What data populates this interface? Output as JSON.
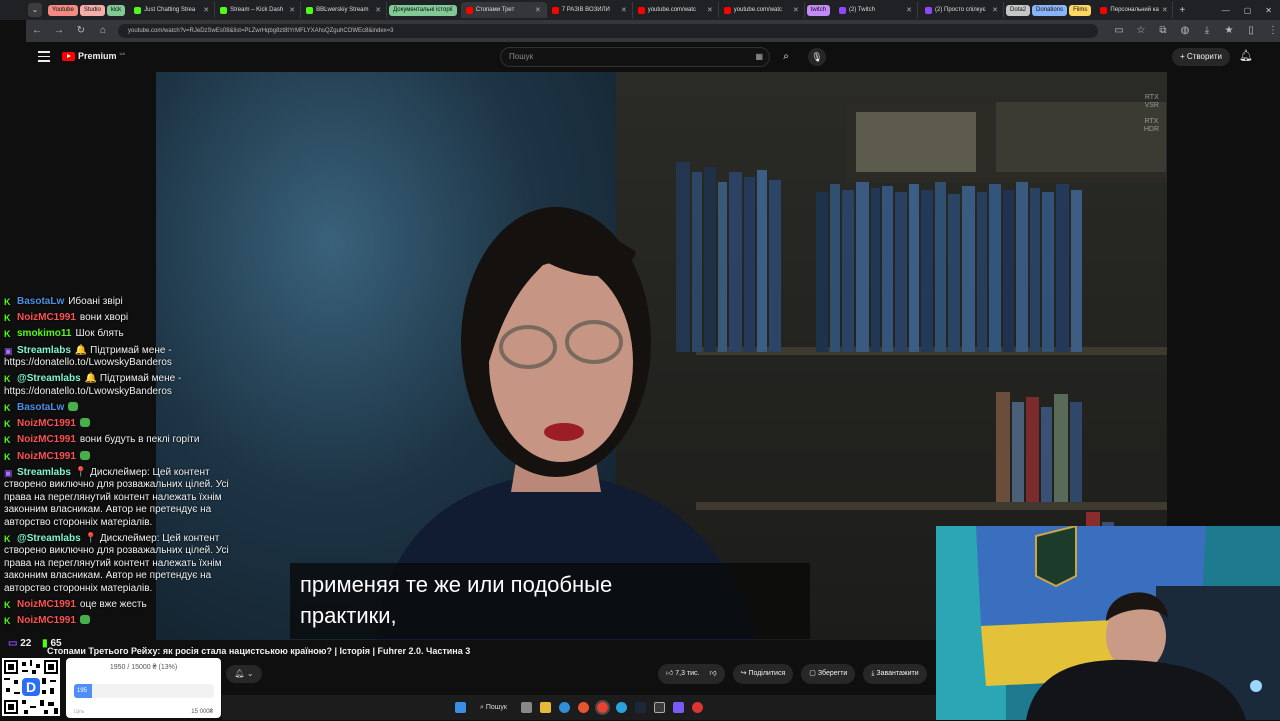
{
  "browser": {
    "groups": [
      {
        "label": "Youtube",
        "color": "#f28b82"
      },
      {
        "label": "Studio",
        "color": "#f6aea9"
      },
      {
        "label": "kick",
        "color": "#81c995"
      }
    ],
    "tabs": [
      {
        "title": "Just Chatting Strea",
        "icon_color": "#53fc18"
      },
      {
        "title": "Stream – Kick Dash",
        "icon_color": "#53fc18"
      },
      {
        "title": "BBLwerskiy Stream",
        "icon_color": "#53fc18"
      }
    ],
    "group_doc": {
      "label": "Документальні історії",
      "color": "#81c995"
    },
    "tabs2": [
      {
        "title": "Стопами Трет",
        "icon_color": "#ff0000",
        "active": true
      },
      {
        "title": "7 РАЗІВ ВОЗИЛИ",
        "icon_color": "#ff0000"
      },
      {
        "title": "youtube.com/watc",
        "icon_color": "#ff0000"
      },
      {
        "title": "youtube.com/watc",
        "icon_color": "#ff0000"
      }
    ],
    "group_twitch": {
      "label": "twitch",
      "color": "#c58af9"
    },
    "tab_twitch": {
      "title": "(2) Twitch",
      "icon_color": "#9146ff"
    },
    "tab_spilk": {
      "title": "(2) Просто спілкує",
      "icon_color": "#9146ff"
    },
    "groups_right": [
      {
        "label": "Dota2",
        "color": "#c4c7c5"
      },
      {
        "label": "Donations",
        "color": "#8ab4f8"
      },
      {
        "label": "Films",
        "color": "#fdd663"
      }
    ],
    "tab_personal": {
      "title": "Персональний ка",
      "icon_color": "#ff0000"
    },
    "url": "youtube.com/watch?v=RJeDzSwEs08&list=PLZwrHqbg8zt8tYrMFLYXAhsQZguhCOWEc8&index=3"
  },
  "youtube": {
    "logo_text": "Premium",
    "logo_sup": "UA",
    "search_placeholder": "Пошук",
    "create_label": "Створити",
    "video_title": "Стопами Третього Рейху: як росія стала нацистською країною? | Історія | Fuhrer 2.0. Частина 3",
    "subtitle_line1": "применяя те же или подобные",
    "subtitle_line2": "практики,",
    "rtx_vsr": [
      "RTX",
      "VSR"
    ],
    "rtx_hdr": [
      "RTX",
      "HDR"
    ],
    "likes": "7,3 тис.",
    "share": "Поділитися",
    "save": "Зберегти",
    "download": "Завантажити"
  },
  "chat": {
    "messages": [
      {
        "user": "BasotaLw",
        "color": "#4a90e2",
        "badge": "kick",
        "text": "Ибоані звірі"
      },
      {
        "user": "NoizMC1991",
        "color": "#ff5151",
        "badge": "kick",
        "text": "вони хворі"
      },
      {
        "user": "smokimo11",
        "color": "#53fc18",
        "badge": "kick",
        "text": "Шок блять"
      },
      {
        "user": "Streamlabs",
        "color": "#80f5d2",
        "badge": "twitch",
        "text": "🔔 Підтримай мене - https://donatello.to/LwowskyBanderos"
      },
      {
        "user": "@Streamlabs",
        "color": "#80f5d2",
        "badge": "kick",
        "text": "🔔 Підтримай мене - https://donatello.to/LwowskyBanderos"
      },
      {
        "user": "BasotaLw",
        "color": "#4a90e2",
        "badge": "kick",
        "text": "",
        "emote": true
      },
      {
        "user": "NoizMC1991",
        "color": "#ff5151",
        "badge": "kick",
        "text": "",
        "emote": true
      },
      {
        "user": "NoizMC1991",
        "color": "#ff5151",
        "badge": "kick",
        "text": "вони будуть в пеклі горіти"
      },
      {
        "user": "NoizMC1991",
        "color": "#ff5151",
        "badge": "kick",
        "text": "",
        "emote": true
      },
      {
        "user": "Streamlabs",
        "color": "#80f5d2",
        "badge": "twitch",
        "text": "📍 Дисклеймер: Цей контент створено виключно для розважальних цілей. Усі права на переглянутий контент належать їхнім законним власникам. Автор не претендує на авторство сторонніх матеріалів."
      },
      {
        "user": "@Streamlabs",
        "color": "#80f5d2",
        "badge": "kick",
        "text": "📍 Дисклеймер: Цей контент створено виключно для розважальних цілей. Усі права на переглянутий контент належать їхнім законним власникам. Автор не претендує на авторство сторонніх матеріалів."
      },
      {
        "user": "NoizMC1991",
        "color": "#ff5151",
        "badge": "kick",
        "text": "оце вже жесть"
      },
      {
        "user": "NoizMC1991",
        "color": "#ff5151",
        "badge": "kick",
        "text": "",
        "emote": true
      }
    ],
    "viewers_twitch": "22",
    "viewers_kick": "65"
  },
  "donation_goal": {
    "text": "1950 / 15000 ₴ (13%)",
    "fill_fraction": 0.13,
    "fill_label": "195",
    "min_label": "Ціль",
    "max_label": "15 000₴"
  },
  "taskbar": {
    "search_label": "Пошук"
  }
}
